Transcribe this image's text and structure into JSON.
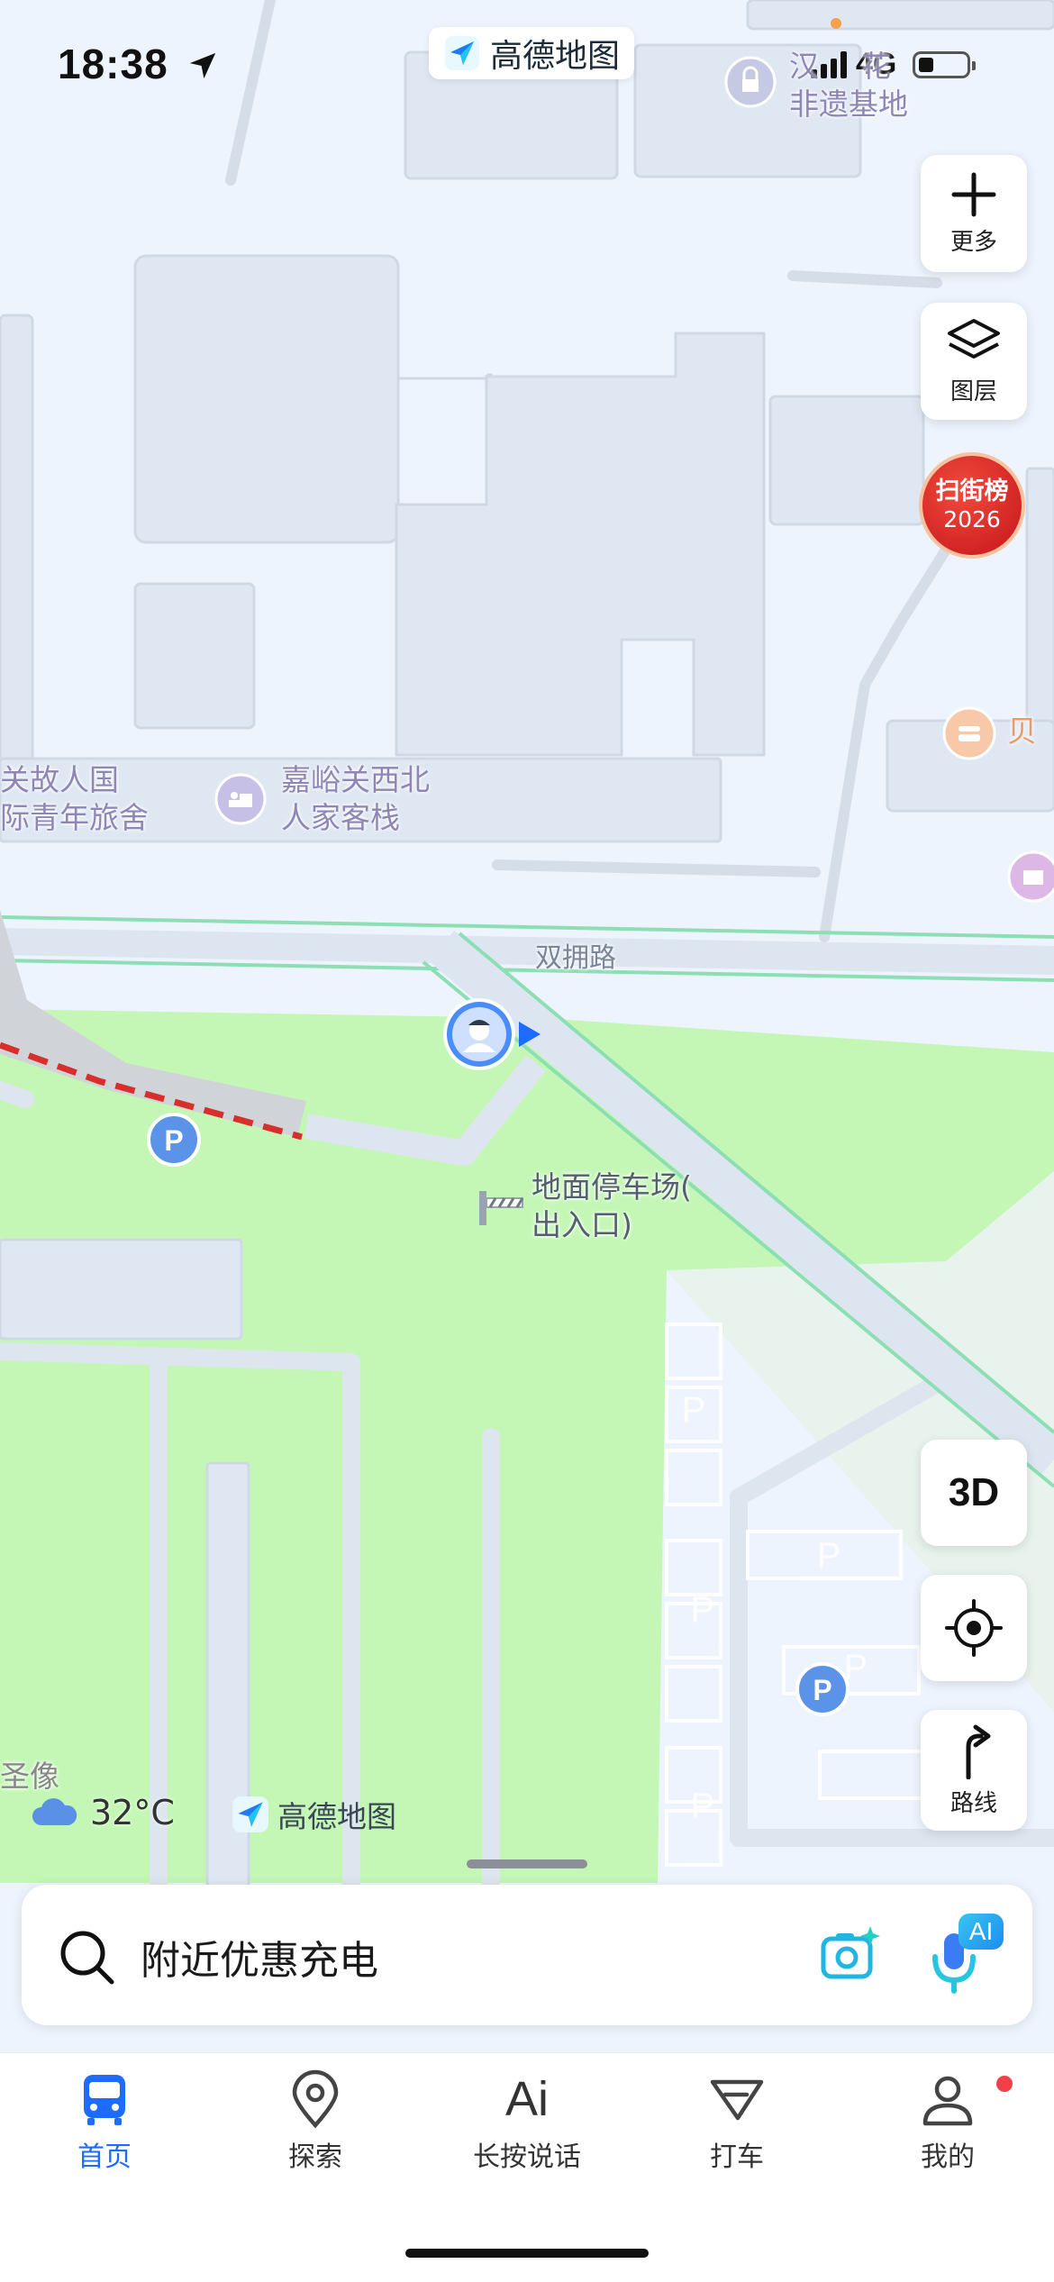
{
  "status_bar": {
    "time": "18:38",
    "network": "4G"
  },
  "brand": {
    "name": "高德地图"
  },
  "map": {
    "labels": {
      "heritage_line1": "汉",
      "heritage_line2": "非遗基地",
      "heritage_partial": "花",
      "hostel_a_line1": "关故人国",
      "hostel_a_line2": "际青年旅舍",
      "hostel_b_line1": "嘉峪关西北",
      "hostel_b_line2": "人家客栈",
      "poi_right": "贝",
      "road_name": "双拥路",
      "parking_gate_line1": "地面停车场(",
      "parking_gate_line2": "出入口)",
      "statue_partial": "圣像"
    },
    "parking_symbol": "P",
    "parking_marks": [
      "P",
      "P",
      "P",
      "P",
      "P"
    ]
  },
  "controls": {
    "more_label": "更多",
    "layers_label": "图层",
    "ranking_line1": "扫街榜",
    "ranking_line2": "2026",
    "view_3d_label": "3D",
    "route_label": "路线"
  },
  "weather": {
    "temperature": "32°C"
  },
  "search": {
    "text": "附近优惠充电",
    "ai_badge": "AI"
  },
  "tabs": [
    {
      "label": "首页"
    },
    {
      "label": "探索"
    },
    {
      "label": "长按说话",
      "icon_text": "Ai"
    },
    {
      "label": "打车"
    },
    {
      "label": "我的"
    }
  ],
  "colors": {
    "accent": "#1e6bff",
    "park_green": "#c4f7b5",
    "map_background": "#eef4fd",
    "building": "#dfe7f2",
    "ranking_badge": "#d21f24"
  }
}
